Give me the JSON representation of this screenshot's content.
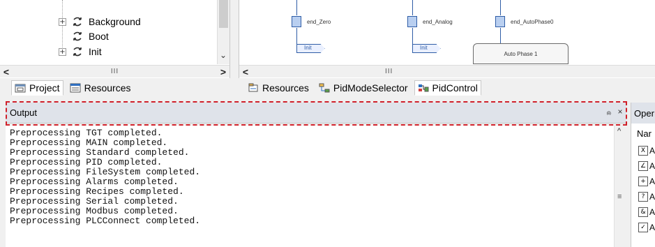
{
  "project_tree": {
    "items": [
      {
        "label": "Background",
        "expandable": true
      },
      {
        "label": "Boot",
        "expandable": false
      },
      {
        "label": "Init",
        "expandable": true
      }
    ],
    "hscroll_grip": "III"
  },
  "diagram": {
    "blocks": [
      {
        "label": "end_Zero",
        "step": "Init"
      },
      {
        "label": "end_Analog",
        "step": "Init"
      },
      {
        "label": "end_AutoPhase0",
        "step": ""
      }
    ],
    "phase_label": "Auto Phase 1",
    "hscroll_grip": "III"
  },
  "left_tabs": [
    {
      "label": "Project",
      "icon": "project-icon",
      "active": true
    },
    {
      "label": "Resources",
      "icon": "resources-icon",
      "active": false
    }
  ],
  "editor_tabs": [
    {
      "label": "Resources",
      "icon": "resources-tab-icon"
    },
    {
      "label": "PidModeSelector",
      "icon": "sfc-icon"
    },
    {
      "label": "PidControl",
      "icon": "fbd-icon"
    }
  ],
  "output": {
    "title": "Output",
    "pin_glyph": "ၐ",
    "close_glyph": "×",
    "lines": [
      "Preprocessing TGT completed.",
      "Preprocessing MAIN completed.",
      "Preprocessing Standard completed.",
      "Preprocessing PID completed.",
      "Preprocessing FileSystem completed.",
      "Preprocessing Alarms completed.",
      "Preprocessing Recipes completed.",
      "Preprocessing Serial completed.",
      "Preprocessing Modbus completed.",
      "Preprocessing PLCConnect completed."
    ],
    "highlight_color": "#d0202a"
  },
  "right_pane": {
    "title": "Oper",
    "column_header": "Nar",
    "icon_glyphs": [
      "X",
      "∠",
      "+",
      "?",
      "&",
      "✓"
    ],
    "row_letter": "A"
  }
}
